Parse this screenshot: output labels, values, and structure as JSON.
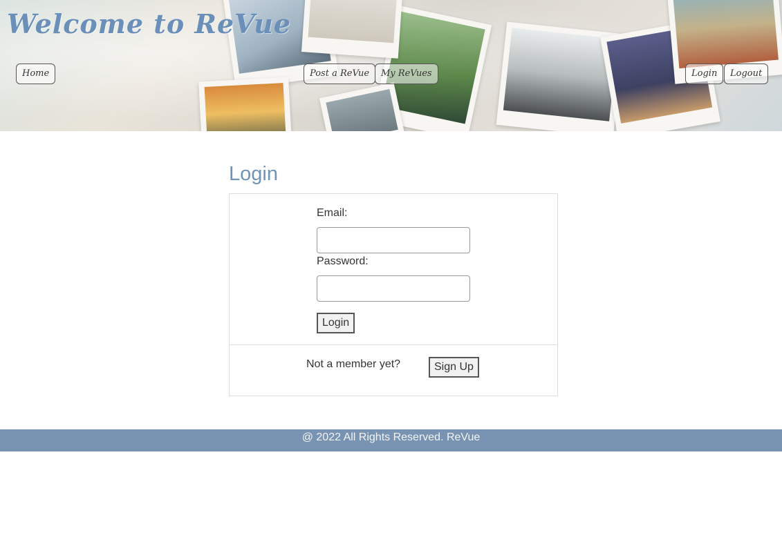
{
  "header": {
    "title": "Welcome to ReVue",
    "nav": {
      "home": "Home",
      "post": "Post a ReVue",
      "my_revues": "My ReVues",
      "login": "Login",
      "logout": "Logout"
    }
  },
  "main": {
    "heading": "Login",
    "email_label": "Email:",
    "email_value": "",
    "password_label": "Password:",
    "password_value": "",
    "login_button": "Login",
    "signup_prompt": "Not a member yet?",
    "signup_button": "Sign Up"
  },
  "footer": {
    "text": "@ 2022 All Rights Reserved. ReVue"
  },
  "colors": {
    "accent": "#6f94b8",
    "footer_bg": "#7994b3"
  }
}
